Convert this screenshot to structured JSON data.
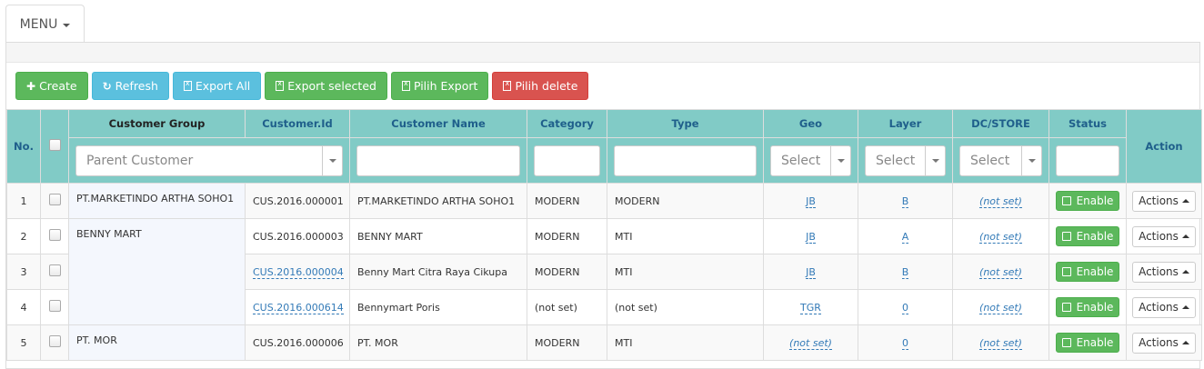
{
  "menu": {
    "label": "MENU"
  },
  "toolbar": {
    "create": "Create",
    "refresh": "Refresh",
    "export_all": "Export All",
    "export_selected": "Export selected",
    "pilih_export": "Pilih Export",
    "pilih_delete": "Pilih delete"
  },
  "columns": {
    "no": "No.",
    "customer_group": "Customer Group",
    "customer_id": "Customer.Id",
    "customer_name": "Customer Name",
    "category": "Category",
    "type": "Type",
    "geo": "Geo",
    "layer": "Layer",
    "dc_store": "DC/STORE",
    "status": "Status",
    "action": "Action"
  },
  "filters": {
    "parent_customer_placeholder": "Parent Customer",
    "geo_placeholder": "Select",
    "layer_placeholder": "Select",
    "dc_store_placeholder": "Select"
  },
  "rows": [
    {
      "no": "1",
      "group": "PT.MARKETINDO ARTHA SOHO1",
      "id": "CUS.2016.000001",
      "name": "PT.MARKETINDO ARTHA SOHO1",
      "category": "MODERN",
      "type": "MODERN",
      "geo": "JB",
      "layer": "B",
      "dc_store": "(not set)",
      "status": "Enable",
      "action": "Actions"
    },
    {
      "no": "2",
      "group": "BENNY MART",
      "id": "CUS.2016.000003",
      "name": "BENNY MART",
      "category": "MODERN",
      "type": "MTI",
      "geo": "JB",
      "layer": "A",
      "dc_store": "(not set)",
      "status": "Enable",
      "action": "Actions"
    },
    {
      "no": "3",
      "group": "",
      "id": "CUS.2016.000004",
      "name": "Benny Mart Citra Raya Cikupa",
      "category": "MODERN",
      "type": "MTI",
      "geo": "JB",
      "layer": "B",
      "dc_store": "(not set)",
      "status": "Enable",
      "action": "Actions"
    },
    {
      "no": "4",
      "group": "",
      "id": "CUS.2016.000614",
      "name": "Bennymart Poris",
      "category": "(not set)",
      "type": "(not set)",
      "geo": "TGR",
      "layer": "0",
      "dc_store": "(not set)",
      "status": "Enable",
      "action": "Actions"
    },
    {
      "no": "5",
      "group": "PT. MOR",
      "id": "CUS.2016.000006",
      "name": "PT. MOR",
      "category": "MODERN",
      "type": "MTI",
      "geo": "(not set)",
      "layer": "0",
      "dc_store": "(not set)",
      "status": "Enable",
      "action": "Actions"
    }
  ],
  "colors": {
    "header_bg": "#81cbc6",
    "btn_green": "#5cb85c",
    "btn_cyan": "#5bc0de",
    "btn_red": "#d9534f",
    "link": "#337ab7"
  }
}
